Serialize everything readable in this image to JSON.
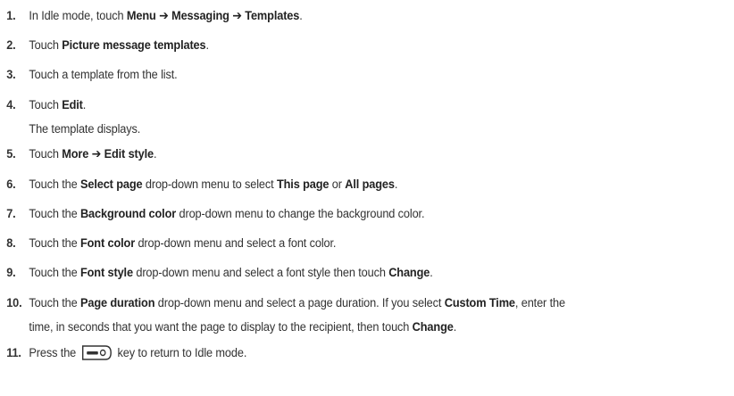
{
  "steps": [
    {
      "number": "1.",
      "lines": [
        [
          {
            "t": "In Idle mode, touch "
          },
          {
            "t": "Menu",
            "b": 1
          },
          {
            "t": " ➔ ",
            "b": 1
          },
          {
            "t": "Messaging",
            "b": 1
          },
          {
            "t": " ➔ ",
            "b": 1
          },
          {
            "t": "Templates",
            "b": 1
          },
          {
            "t": "."
          }
        ]
      ]
    },
    {
      "number": "2.",
      "lines": [
        [
          {
            "t": "Touch "
          },
          {
            "t": "Picture message templates",
            "b": 1
          },
          {
            "t": "."
          }
        ]
      ]
    },
    {
      "number": "3.",
      "lines": [
        [
          {
            "t": "Touch a template from the list."
          }
        ]
      ]
    },
    {
      "number": "4.",
      "lines": [
        [
          {
            "t": "Touch "
          },
          {
            "t": "Edit",
            "b": 1
          },
          {
            "t": "."
          }
        ],
        [
          {
            "t": "The template displays."
          }
        ]
      ]
    },
    {
      "number": "5.",
      "lines": [
        [
          {
            "t": "Touch "
          },
          {
            "t": "More",
            "b": 1
          },
          {
            "t": " ➔ ",
            "b": 1
          },
          {
            "t": "Edit style",
            "b": 1
          },
          {
            "t": "."
          }
        ]
      ]
    },
    {
      "number": "6.",
      "lines": [
        [
          {
            "t": "Touch the "
          },
          {
            "t": "Select page",
            "b": 1
          },
          {
            "t": " drop-down menu to select "
          },
          {
            "t": "This page",
            "b": 1
          },
          {
            "t": " or "
          },
          {
            "t": "All pages",
            "b": 1
          },
          {
            "t": "."
          }
        ]
      ]
    },
    {
      "number": "7.",
      "lines": [
        [
          {
            "t": "Touch the "
          },
          {
            "t": "Background color",
            "b": 1
          },
          {
            "t": " drop-down menu to change the background color."
          }
        ]
      ]
    },
    {
      "number": "8.",
      "lines": [
        [
          {
            "t": "Touch the "
          },
          {
            "t": "Font color",
            "b": 1
          },
          {
            "t": " drop-down menu and select a font color."
          }
        ]
      ]
    },
    {
      "number": "9.",
      "lines": [
        [
          {
            "t": "Touch the "
          },
          {
            "t": "Font style",
            "b": 1
          },
          {
            "t": " drop-down menu and select a font style then touch "
          },
          {
            "t": "Change",
            "b": 1
          },
          {
            "t": "."
          }
        ]
      ]
    },
    {
      "number": "10.",
      "lines": [
        [
          {
            "t": "Touch the "
          },
          {
            "t": "Page duration",
            "b": 1
          },
          {
            "t": " drop-down menu and select a page duration. If you select "
          },
          {
            "t": "Custom Time",
            "b": 1
          },
          {
            "t": ", enter the"
          }
        ],
        [
          {
            "t": "time, in seconds that you want the page to display to the recipient, then touch "
          },
          {
            "t": "Change",
            "b": 1
          },
          {
            "t": "."
          }
        ]
      ]
    },
    {
      "number": "11.",
      "lines": [
        [
          {
            "t": "Press the "
          },
          {
            "icon": "end-key-icon"
          },
          {
            "t": " key to return to Idle mode."
          }
        ]
      ]
    }
  ]
}
